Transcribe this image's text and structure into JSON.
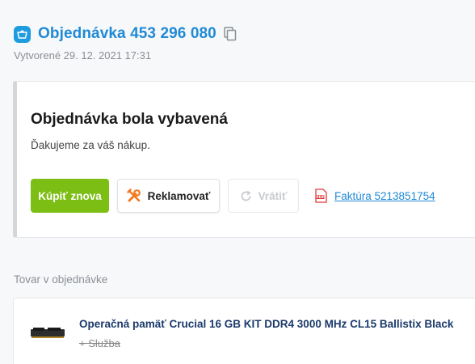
{
  "header": {
    "title": "Objednávka 453 296 080",
    "created": "Vytvorené 29. 12. 2021 17:31"
  },
  "status_card": {
    "title": "Objednávka bola vybavená",
    "subtitle": "Ďakujeme za váš nákup.",
    "buy_again_label": "Kúpiť znova",
    "claim_label": "Reklamovať",
    "return_label": "Vrátiť",
    "invoice_label": "Faktúra 5213851754"
  },
  "items_section": {
    "label": "Tovar v objednávke",
    "items": [
      {
        "name": "Operačná pamäť Crucial 16 GB KIT DDR4 3000 MHz CL15 Ballistix Black",
        "service": "+ Služba"
      }
    ]
  },
  "colors": {
    "accent_blue": "#1f8ad6",
    "buy_green": "#7cbe14",
    "claim_orange": "#f47a1f",
    "pdf_red": "#e23b3b"
  }
}
